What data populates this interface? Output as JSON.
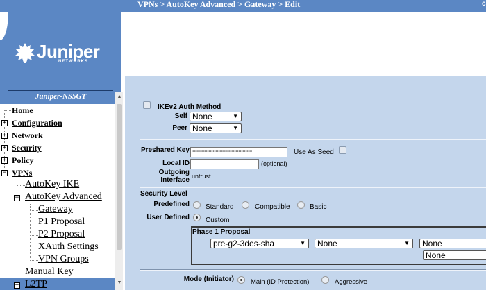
{
  "breadcrumb": {
    "text": "VPNs > AutoKey Advanced > Gateway > Edit"
  },
  "logo": {
    "brand": "Juniper",
    "sub": "NETWORKS",
    "icon": "juniper-logo-icon"
  },
  "device": {
    "name": "Juniper-NS5GT"
  },
  "nav": {
    "top": [
      {
        "label": "Home",
        "expander": ""
      },
      {
        "label": "Configuration",
        "expander": "+"
      },
      {
        "label": "Network",
        "expander": "+"
      },
      {
        "label": "Security",
        "expander": "+"
      },
      {
        "label": "Policy",
        "expander": "+"
      },
      {
        "label": "VPNs",
        "expander": "−"
      }
    ],
    "vpn_children": {
      "autokey_ike": "AutoKey IKE",
      "autokey_advanced": "AutoKey Advanced",
      "gateway": "Gateway",
      "p1_proposal": "P1 Proposal",
      "p2_proposal": "P2 Proposal",
      "xauth_settings": "XAuth Settings",
      "vpn_groups": "VPN Groups",
      "manual_key": "Manual Key",
      "l2tp": "L2TP"
    }
  },
  "form": {
    "ikev2_auth_method": "IKEv2 Auth Method",
    "self_label": "Self",
    "self_value": "None",
    "peer_label": "Peer",
    "peer_value": "None",
    "preshared_key_label": "Preshared Key",
    "preshared_key_value": "••••••••••••••••••••••••••••••••••••••••••••",
    "use_as_seed_label": "Use As Seed",
    "local_id_label": "Local ID",
    "local_id_value": "",
    "local_id_hint": "(optional)",
    "outgoing_interface_label_1": "Outgoing",
    "outgoing_interface_label_2": "Interface",
    "outgoing_interface_value": "untrust",
    "security_level_label": "Security Level",
    "predefined_label": "Predefined",
    "opt_standard": "Standard",
    "opt_compatible": "Compatible",
    "opt_basic": "Basic",
    "user_defined_label": "User Defined",
    "opt_custom": "Custom",
    "phase1_label": "Phase 1 Proposal",
    "phase1_1": "pre-g2-3des-sha",
    "phase1_2": "None",
    "phase1_3": "None",
    "phase1_4": "None",
    "mode_label": "Mode (Initiator)",
    "mode_main": "Main (ID Protection)",
    "mode_aggressive": "Aggressive"
  }
}
